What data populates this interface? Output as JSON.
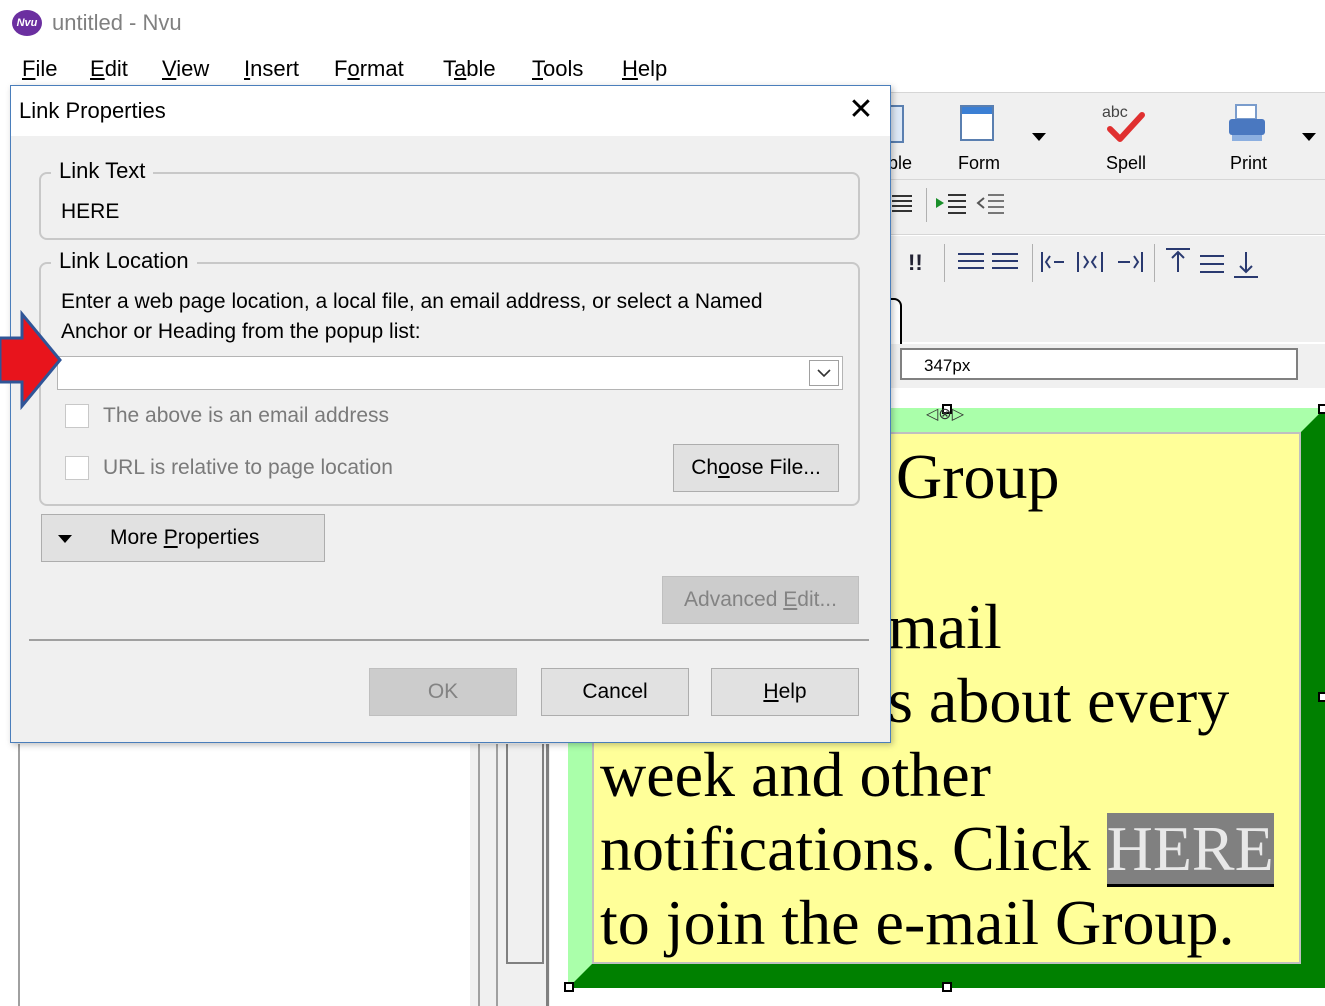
{
  "window": {
    "title": "untitled - Nvu",
    "logo_text": "Nvu"
  },
  "menubar": {
    "items": [
      {
        "label": "File",
        "accel": "F",
        "rest": "ile"
      },
      {
        "label": "Edit",
        "accel": "E",
        "rest": "dit"
      },
      {
        "label": "View",
        "accel": "V",
        "rest": "iew"
      },
      {
        "label": "Insert",
        "accel": "I",
        "rest": "nsert"
      },
      {
        "label": "Format",
        "pre": "F",
        "accel": "o",
        "rest": "rmat"
      },
      {
        "label": "Table",
        "pre": "T",
        "accel": "a",
        "rest": "ble"
      },
      {
        "label": "Tools",
        "accel": "T",
        "rest": "ools"
      },
      {
        "label": "Help",
        "accel": "H",
        "rest": "elp"
      }
    ]
  },
  "toolbar": {
    "partial_label": "ble",
    "form_label": "Form",
    "spell_label": "Spell",
    "print_label": "Print"
  },
  "properties_bar": {
    "width_value": "347px"
  },
  "editor": {
    "lines": [
      "Group",
      "",
      "mail",
      "s about every",
      "week and other",
      "notifications.  Click ",
      "to join the e-mail Group."
    ],
    "link_text": "HERE"
  },
  "dialog": {
    "title": "Link Properties",
    "close_symbol": "✕",
    "link_text_group": {
      "legend": "Link Text",
      "value": "HERE"
    },
    "link_location_group": {
      "legend": "Link Location",
      "instructions_line1": "Enter a web page location, a local file, an email address, or select a Named",
      "instructions_line2": "Anchor or Heading from the popup list:",
      "url_value": "",
      "email_checkbox_label": "The above is an email address",
      "relative_checkbox_label": "URL is relative to page location",
      "choose_file_pre": "Ch",
      "choose_file_accel": "o",
      "choose_file_rest": "ose File..."
    },
    "more_properties": {
      "pre": "More ",
      "accel": "P",
      "rest": "roperties"
    },
    "advanced_edit": {
      "pre": "Advanced ",
      "accel": "E",
      "rest": "dit..."
    },
    "ok_label": "OK",
    "cancel_label": "Cancel",
    "help": {
      "accel": "H",
      "rest": "elp"
    }
  },
  "colors": {
    "annotation_arrow": "#e8141c",
    "arrow_outline": "#2f5597",
    "table_border_light": "#aaffaa",
    "table_border_dark": "#008000",
    "cell_background": "#ffff99"
  }
}
